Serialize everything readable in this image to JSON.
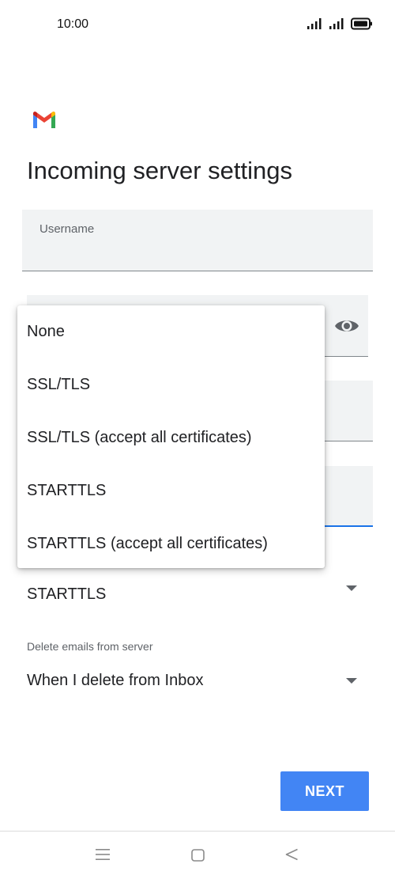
{
  "status_bar": {
    "time": "10:00"
  },
  "header": {
    "logo": "gmail-icon",
    "title": "Incoming server settings"
  },
  "form": {
    "username_label": "Username",
    "security_value": "STARTTLS",
    "delete_label": "Delete emails from server",
    "delete_value": "When I delete from Inbox"
  },
  "security_menu": {
    "options": [
      "None",
      "SSL/TLS",
      "SSL/TLS (accept all certificates)",
      "STARTTLS",
      "STARTTLS (accept all certificates)"
    ]
  },
  "footer": {
    "next_label": "NEXT"
  },
  "nav": {
    "icons": [
      "menu-icon",
      "home-icon",
      "back-icon"
    ]
  },
  "colors": {
    "accent": "#4285f4",
    "focus_underline": "#1a73e8",
    "field_bg": "#f1f3f4"
  }
}
